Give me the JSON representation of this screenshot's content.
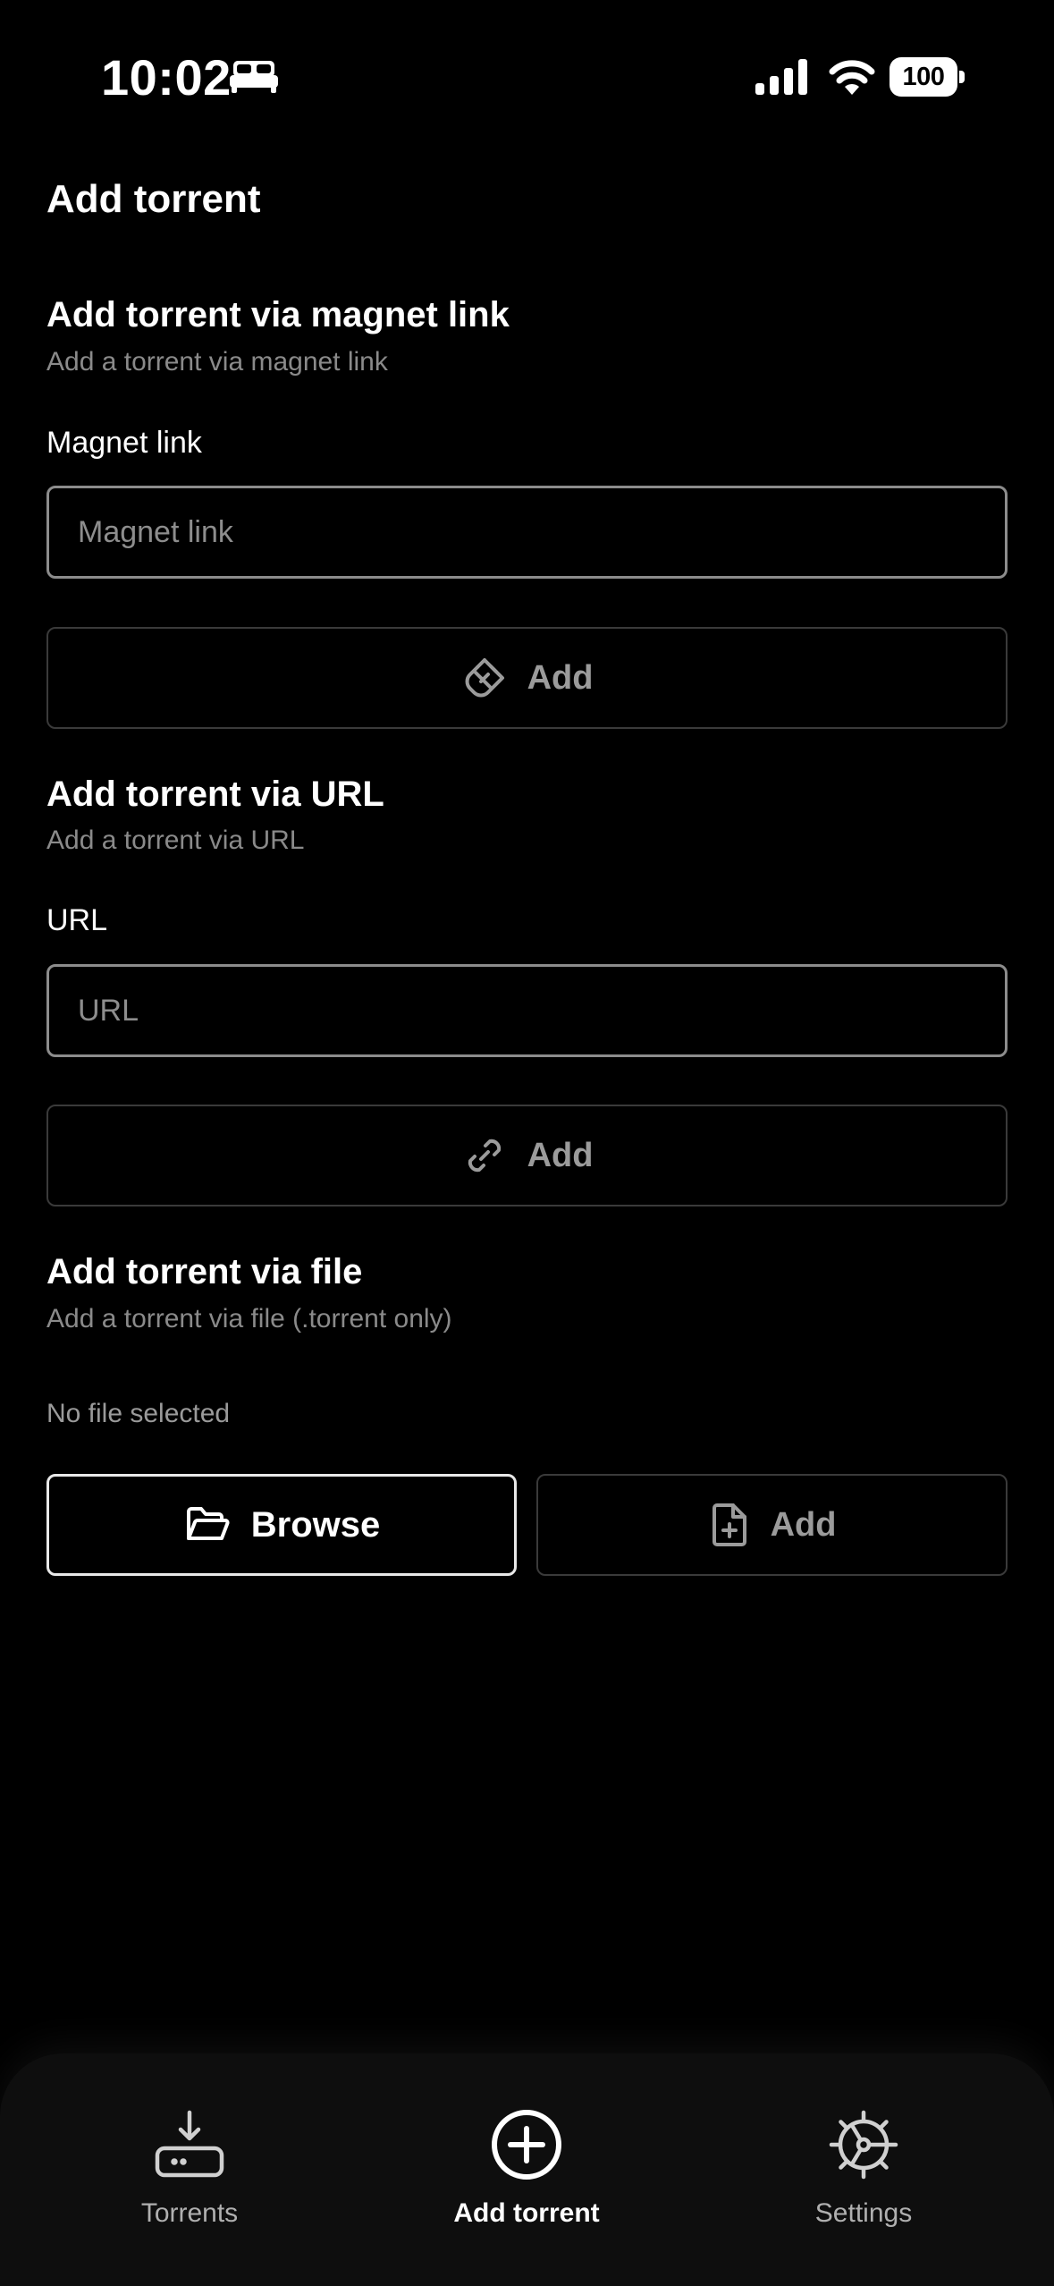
{
  "status_bar": {
    "time": "10:02",
    "battery": "100",
    "icons": [
      "bed-icon",
      "signal-icon",
      "wifi-icon",
      "battery-icon"
    ]
  },
  "page": {
    "title": "Add torrent"
  },
  "magnet_section": {
    "title": "Add torrent via magnet link",
    "subtitle": "Add a torrent via magnet link",
    "field_label": "Magnet link",
    "placeholder": "Magnet link",
    "value": "",
    "button_label": "Add",
    "button_icon": "magnet-icon"
  },
  "url_section": {
    "title": "Add torrent via URL",
    "subtitle": "Add a torrent via URL",
    "field_label": "URL",
    "placeholder": "URL",
    "value": "",
    "button_label": "Add",
    "button_icon": "link-icon"
  },
  "file_section": {
    "title": "Add torrent via file",
    "subtitle": "Add a torrent via file (.torrent only)",
    "status": "No file selected",
    "browse_label": "Browse",
    "browse_icon": "folder-open-icon",
    "add_label": "Add",
    "add_icon": "file-plus-icon"
  },
  "bottom_nav": {
    "items": [
      {
        "label": "Torrents",
        "icon": "download-tray-icon",
        "active": false
      },
      {
        "label": "Add torrent",
        "icon": "plus-circle-icon",
        "active": true
      },
      {
        "label": "Settings",
        "icon": "gear-icon",
        "active": false
      }
    ]
  },
  "colors": {
    "background": "#000000",
    "text": "#ffffff",
    "muted_text": "#8a8a8a",
    "input_border": "#8c8c8c",
    "disabled_border": "#3a3a3a",
    "nav_background": "#0e0e0e"
  }
}
